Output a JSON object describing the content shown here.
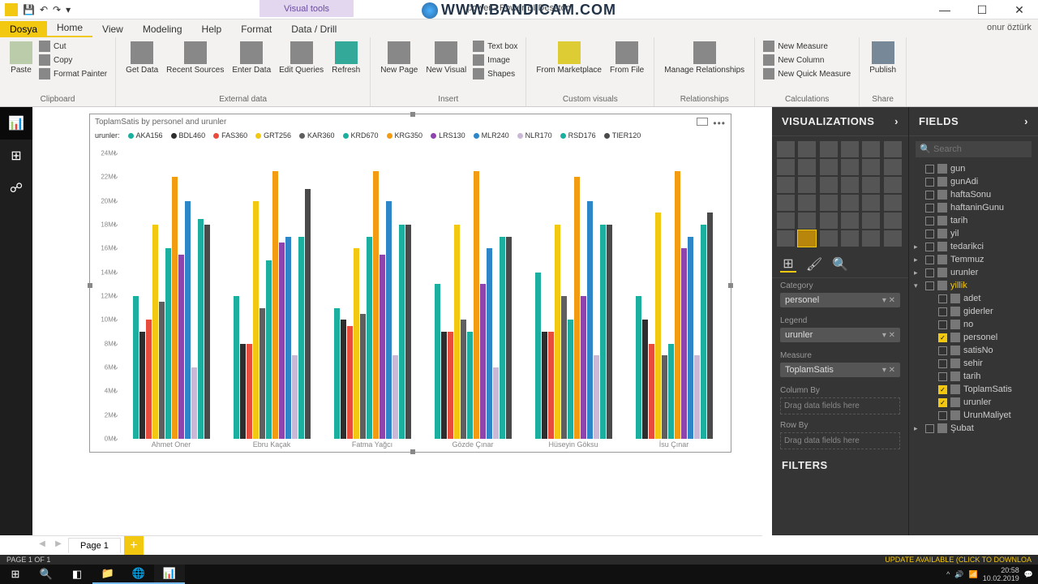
{
  "watermark": "WWW.BANDICAM.COM",
  "window": {
    "title": "power - Power BI Desktop",
    "visual_tools": "Visual tools",
    "user": "onur öztürk"
  },
  "tabs": {
    "file": "Dosya",
    "home": "Home",
    "view": "View",
    "modeling": "Modeling",
    "help": "Help",
    "format": "Format",
    "data_drill": "Data / Drill"
  },
  "ribbon": {
    "paste": "Paste",
    "cut": "Cut",
    "copy": "Copy",
    "format_painter": "Format Painter",
    "clipboard": "Clipboard",
    "get_data": "Get\nData",
    "recent_sources": "Recent\nSources",
    "enter_data": "Enter\nData",
    "edit_queries": "Edit\nQueries",
    "refresh": "Refresh",
    "external_data": "External data",
    "new_page": "New\nPage",
    "new_visual": "New\nVisual",
    "text_box": "Text box",
    "image": "Image",
    "shapes": "Shapes",
    "insert": "Insert",
    "from_marketplace": "From\nMarketplace",
    "from_file": "From\nFile",
    "custom_visuals": "Custom visuals",
    "manage_relationships": "Manage\nRelationships",
    "relationships": "Relationships",
    "new_measure": "New Measure",
    "new_column": "New Column",
    "new_quick_measure": "New Quick Measure",
    "calculations": "Calculations",
    "publish": "Publish",
    "share": "Share"
  },
  "chart": {
    "title": "ToplamSatis by personel and urunler",
    "legend_label": "urunler:"
  },
  "chart_data": {
    "type": "bar",
    "ylabel": "",
    "ylim": [
      0,
      24000000
    ],
    "yticks": [
      "0M₺",
      "2M₺",
      "4M₺",
      "6M₺",
      "8M₺",
      "10M₺",
      "12M₺",
      "14M₺",
      "16M₺",
      "18M₺",
      "20M₺",
      "22M₺",
      "24M₺"
    ],
    "categories": [
      "Ahmet Oner",
      "Ebru Kaçak",
      "Fatma Yağcı",
      "Gözde Çınar",
      "Hüseyin Göksu",
      "İsu Çınar"
    ],
    "series": [
      {
        "name": "AKA156",
        "color": "#1aaf9e",
        "values": [
          12,
          12,
          11,
          13,
          14,
          12
        ]
      },
      {
        "name": "BDL460",
        "color": "#2e2e2e",
        "values": [
          9,
          8,
          10,
          9,
          9,
          10
        ]
      },
      {
        "name": "FAS360",
        "color": "#e74c3c",
        "values": [
          10,
          8,
          9.5,
          9,
          9,
          8
        ]
      },
      {
        "name": "GRT256",
        "color": "#f2c811",
        "values": [
          18,
          20,
          16,
          18,
          18,
          19
        ]
      },
      {
        "name": "KAR360",
        "color": "#5f5f5f",
        "values": [
          11.5,
          11,
          10.5,
          10,
          12,
          7
        ]
      },
      {
        "name": "KRD670",
        "color": "#1aaf9e",
        "values": [
          16,
          15,
          17,
          9,
          10,
          8
        ]
      },
      {
        "name": "KRG350",
        "color": "#f39c12",
        "values": [
          22,
          22.5,
          22.5,
          22.5,
          22,
          22.5
        ]
      },
      {
        "name": "LRS130",
        "color": "#8e44ad",
        "values": [
          15.5,
          16.5,
          15.5,
          13,
          12,
          16
        ]
      },
      {
        "name": "MLR240",
        "color": "#2c86c7",
        "values": [
          20,
          17,
          20,
          16,
          20,
          17
        ]
      },
      {
        "name": "NLR170",
        "color": "#c9b8d6",
        "values": [
          6,
          7,
          7,
          6,
          7,
          7
        ]
      },
      {
        "name": "RSD176",
        "color": "#1aaf9e",
        "values": [
          18.5,
          17,
          18,
          17,
          18,
          18
        ]
      },
      {
        "name": "TIER120",
        "color": "#4a4a4a",
        "values": [
          18,
          21,
          18,
          17,
          18,
          19
        ]
      }
    ]
  },
  "vis_panel": {
    "title": "VISUALIZATIONS",
    "category": "Category",
    "category_val": "personel",
    "legend": "Legend",
    "legend_val": "urunler",
    "measure": "Measure",
    "measure_val": "ToplamSatis",
    "column_by": "Column By",
    "row_by": "Row By",
    "drag_hint": "Drag data fields here",
    "filters": "FILTERS"
  },
  "fields_panel": {
    "title": "FIELDS",
    "search_placeholder": "Search",
    "items": [
      {
        "n": "gun",
        "c": false,
        "t": false
      },
      {
        "n": "gunAdi",
        "c": false,
        "t": false
      },
      {
        "n": "haftaSonu",
        "c": false,
        "t": false
      },
      {
        "n": "haftaninGunu",
        "c": false,
        "t": false
      },
      {
        "n": "tarih",
        "c": false,
        "t": false
      },
      {
        "n": "yil",
        "c": false,
        "t": false
      },
      {
        "n": "tedarikci",
        "c": false,
        "t": true
      },
      {
        "n": "Temmuz",
        "c": false,
        "t": true
      },
      {
        "n": "urunler",
        "c": false,
        "t": true
      },
      {
        "n": "yillik",
        "c": false,
        "t": true,
        "active": true,
        "expanded": true
      },
      {
        "n": "adet",
        "c": false,
        "t": false,
        "indent": true
      },
      {
        "n": "giderler",
        "c": false,
        "t": false,
        "indent": true
      },
      {
        "n": "no",
        "c": false,
        "t": false,
        "indent": true
      },
      {
        "n": "personel",
        "c": true,
        "t": false,
        "indent": true
      },
      {
        "n": "satisNo",
        "c": false,
        "t": false,
        "indent": true
      },
      {
        "n": "sehir",
        "c": false,
        "t": false,
        "indent": true
      },
      {
        "n": "tarih",
        "c": false,
        "t": false,
        "indent": true
      },
      {
        "n": "ToplamSatis",
        "c": true,
        "t": false,
        "indent": true
      },
      {
        "n": "urunler",
        "c": true,
        "t": false,
        "indent": true
      },
      {
        "n": "UrunMaliyet",
        "c": false,
        "t": false,
        "indent": true
      },
      {
        "n": "Şubat",
        "c": false,
        "t": true
      }
    ]
  },
  "pagetabs": {
    "page1": "Page 1"
  },
  "status": {
    "left": "PAGE 1 OF 1",
    "right": "UPDATE AVAILABLE (CLICK TO DOWNLOA"
  },
  "tray": {
    "time": "20:58",
    "date": "10.02.2019"
  }
}
